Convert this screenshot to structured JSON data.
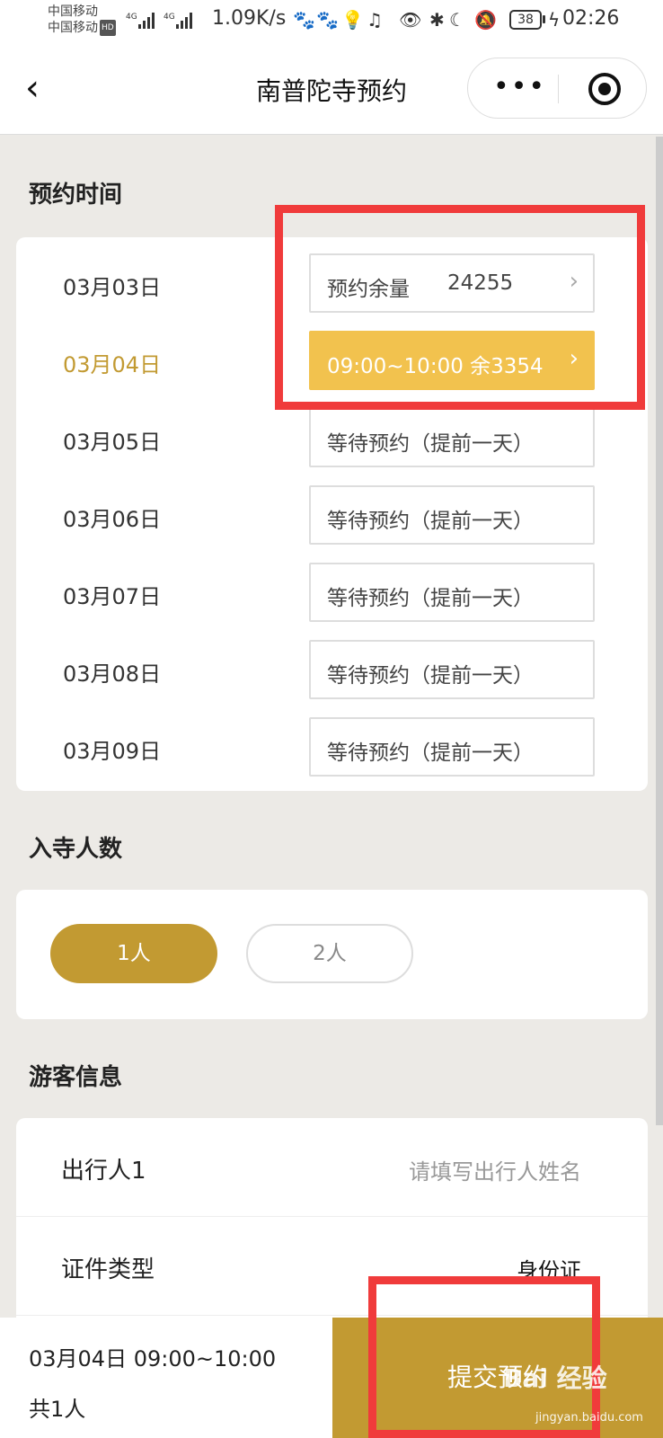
{
  "status_bar": {
    "carrier_1": "中国移动",
    "carrier_2": "中国移动",
    "hd": "HD",
    "net_1": "4G",
    "net_2": "4G",
    "speed": "1.09K/s",
    "battery": "38",
    "time": "02:26"
  },
  "nav": {
    "back_glyph": "‹",
    "title": "南普陀寺预约",
    "more_glyph": "•••"
  },
  "booking_time": {
    "title": "预约时间",
    "rows": [
      {
        "date": "03月03日",
        "slot": "预约余量",
        "value": "24255",
        "state": "info"
      },
      {
        "date": "03月04日",
        "slot": "09:00~10:00  余3354",
        "value": "",
        "state": "selected"
      },
      {
        "date": "03月05日",
        "slot": "等待预约（提前一天）",
        "value": "",
        "state": "waiting"
      },
      {
        "date": "03月06日",
        "slot": "等待预约（提前一天）",
        "value": "",
        "state": "waiting"
      },
      {
        "date": "03月07日",
        "slot": "等待预约（提前一天）",
        "value": "",
        "state": "waiting"
      },
      {
        "date": "03月08日",
        "slot": "等待预约（提前一天）",
        "value": "",
        "state": "waiting"
      },
      {
        "date": "03月09日",
        "slot": "等待预约（提前一天）",
        "value": "",
        "state": "waiting"
      }
    ]
  },
  "visitors_count": {
    "title": "入寺人数",
    "options": [
      "1人",
      "2人"
    ],
    "selected": "1人"
  },
  "visitor_info": {
    "title": "游客信息",
    "traveler_label": "出行人1",
    "traveler_placeholder": "请填写出行人姓名",
    "id_type_label": "证件类型",
    "id_type_value": "身份证"
  },
  "bottom_bar": {
    "summary_time": "03月04日 09:00~10:00",
    "summary_count": "共1人",
    "submit": "提交预约"
  },
  "watermark": {
    "main": "Bai 经验",
    "sub": "jingyan.baidu.com"
  },
  "colors": {
    "accent": "#C29A32",
    "selected_slot": "#F2C24E",
    "annotation": "#F03B3B",
    "background": "#ECEAE6"
  }
}
